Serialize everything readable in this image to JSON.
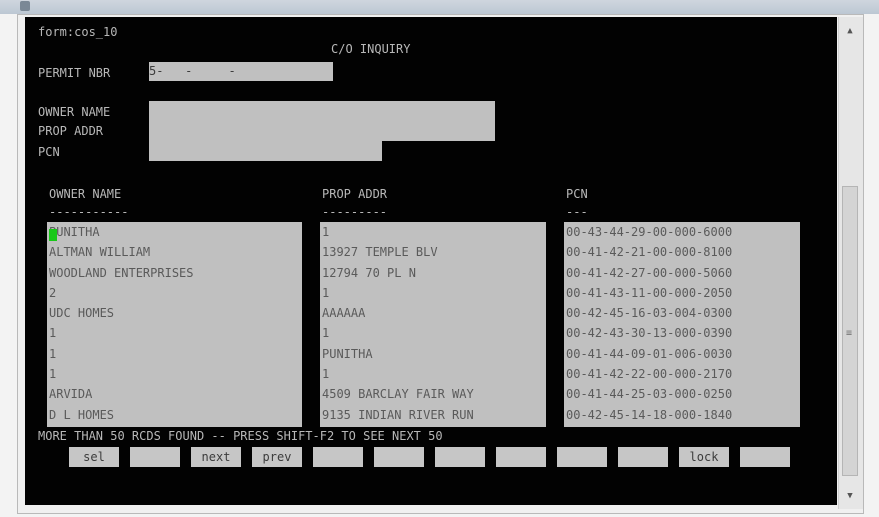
{
  "window": {
    "title": ""
  },
  "terminal": {
    "form_id": "form:cos_10",
    "screen_title": "C/O INQUIRY",
    "permit_label": "PERMIT NBR",
    "permit_value": "5-   -     -",
    "owner_name_label": "OWNER NAME",
    "prop_addr_label": "PROP ADDR",
    "pcn_label": "PCN",
    "list_headers": [
      "OWNER NAME",
      "PROP ADDR",
      "PCN"
    ],
    "list_underlines": [
      "-----------",
      "---------",
      "---"
    ],
    "rows": [
      {
        "owner": "PUNITHA",
        "addr": "1",
        "pcn": "00-43-44-29-00-000-6000"
      },
      {
        "owner": "ALTMAN WILLIAM",
        "addr": "13927 TEMPLE BLV",
        "pcn": "00-41-42-21-00-000-8100"
      },
      {
        "owner": "WOODLAND ENTERPRISES",
        "addr": "12794 70 PL N",
        "pcn": "00-41-42-27-00-000-5060"
      },
      {
        "owner": "2",
        "addr": "1",
        "pcn": "00-41-43-11-00-000-2050"
      },
      {
        "owner": "UDC HOMES",
        "addr": "AAAAAA",
        "pcn": "00-42-45-16-03-004-0300"
      },
      {
        "owner": "1",
        "addr": "1",
        "pcn": "00-42-43-30-13-000-0390"
      },
      {
        "owner": "1",
        "addr": "PUNITHA",
        "pcn": "00-41-44-09-01-006-0030"
      },
      {
        "owner": "1",
        "addr": "1",
        "pcn": "00-41-42-22-00-000-2170"
      },
      {
        "owner": "ARVIDA",
        "addr": "4509 BARCLAY FAIR WAY",
        "pcn": "00-41-44-25-03-000-0250"
      },
      {
        "owner": "D L HOMES",
        "addr": "9135 INDIAN RIVER RUN",
        "pcn": "00-42-45-14-18-000-1840"
      }
    ],
    "status_message": "MORE THAN 50 RCDS FOUND -- PRESS SHIFT-F2 TO SEE NEXT 50",
    "function_keys": [
      "sel",
      "",
      "next",
      "prev",
      "",
      "",
      "",
      "",
      "",
      "",
      "lock",
      ""
    ]
  },
  "icons": {
    "scroll_up": "scroll-up-arrow-icon",
    "scroll_down": "scroll-down-arrow-icon",
    "grip": "scrollbar-grip-icon"
  }
}
